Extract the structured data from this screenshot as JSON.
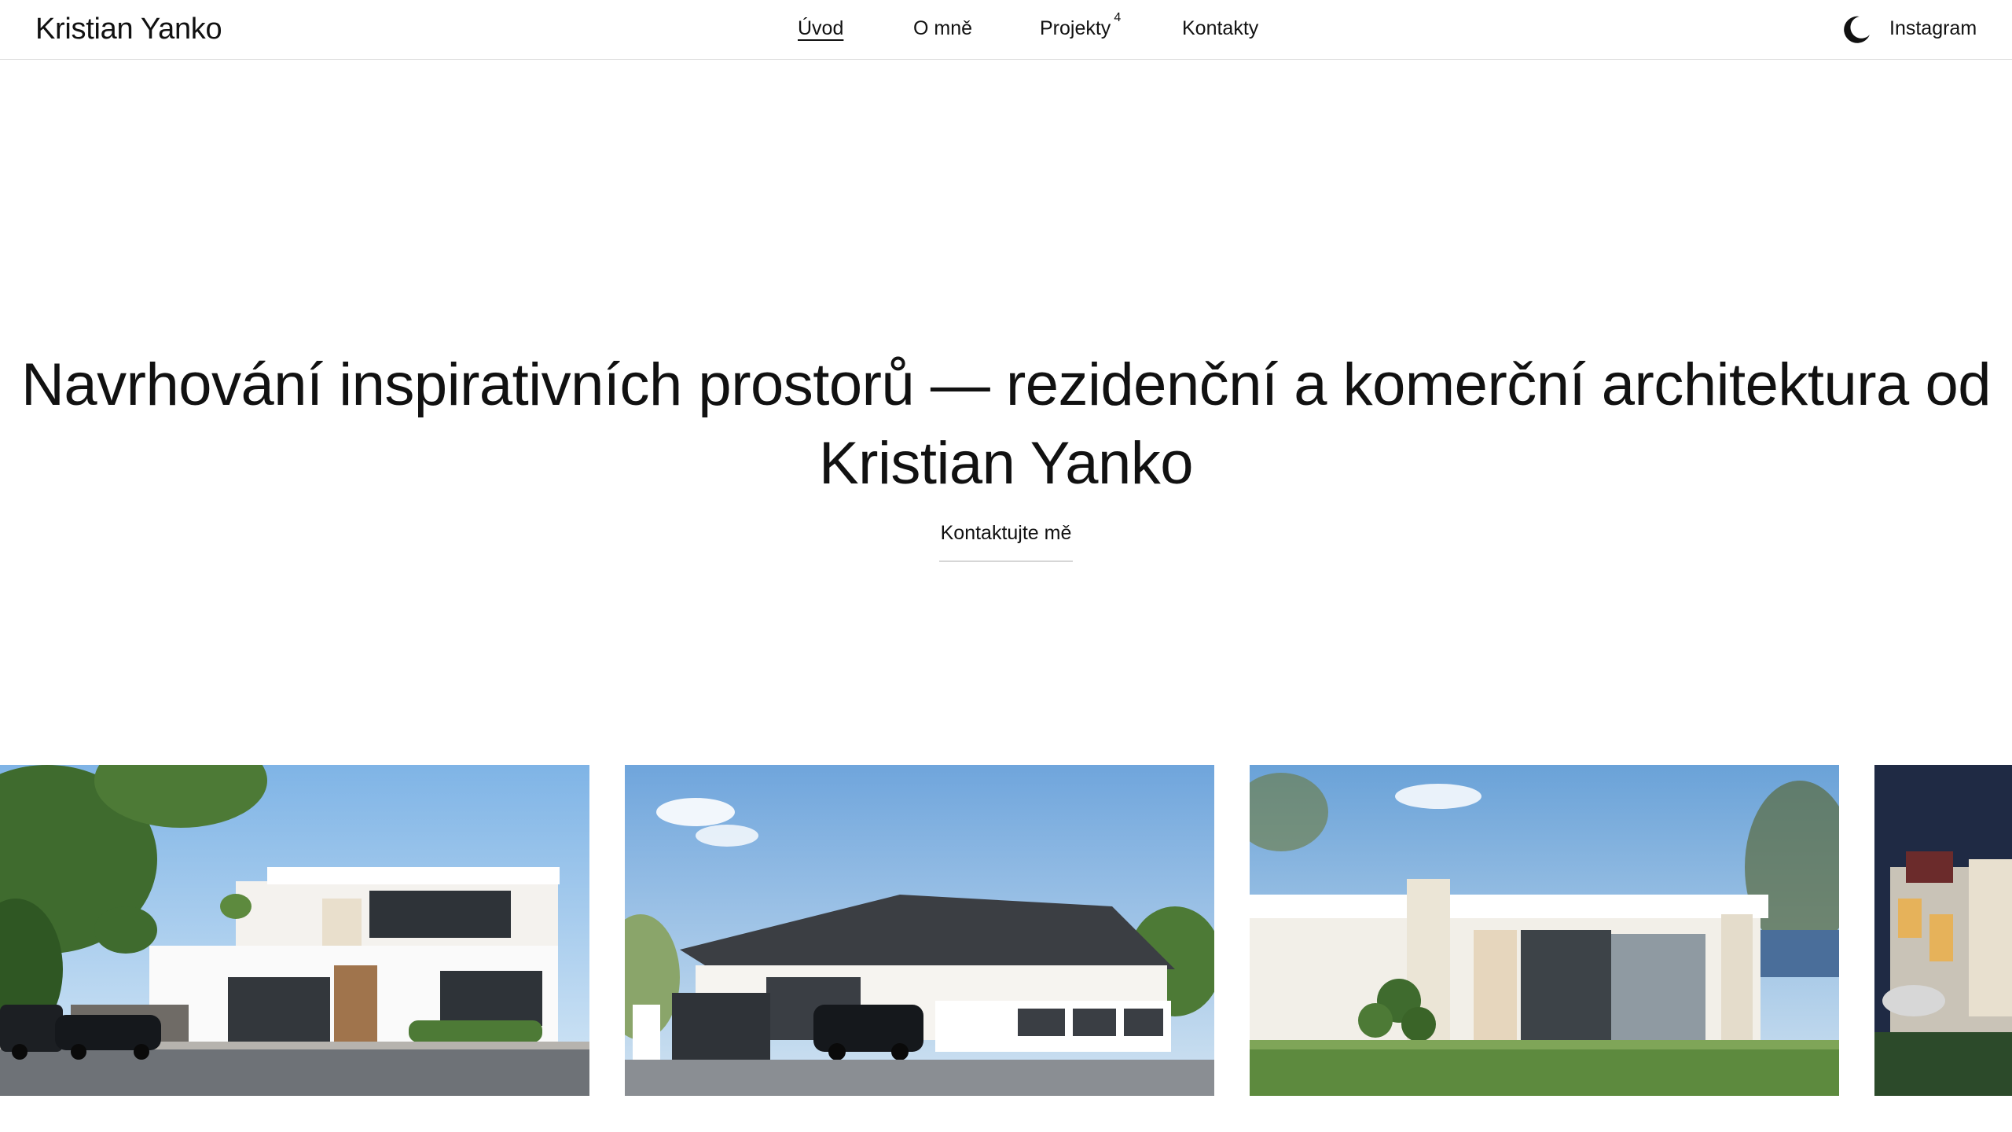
{
  "brand": {
    "name": "Kristian Yanko"
  },
  "nav": {
    "items": [
      {
        "label": "Úvod",
        "active": true
      },
      {
        "label": "O mně",
        "active": false
      },
      {
        "label": "Projekty",
        "count": "4",
        "active": false
      },
      {
        "label": "Kontakty",
        "active": false
      }
    ]
  },
  "header": {
    "theme_icon": "moon-icon",
    "instagram_label": "Instagram"
  },
  "hero": {
    "title_line1": "Navrhování inspirativních prostorů — rezidenční a komerční architektura od",
    "title_line2": "Kristian Yanko",
    "cta_label": "Kontaktujte mě"
  },
  "gallery": {
    "items": [
      {
        "name": "modern two-storey villa with garage"
      },
      {
        "name": "bungalow with hip roof and fence"
      },
      {
        "name": "flat roof single-storey house with garden"
      },
      {
        "name": "classical villa at night"
      }
    ]
  },
  "colors": {
    "text": "#111111",
    "background": "#ffffff",
    "divider": "#dcdcdc"
  }
}
